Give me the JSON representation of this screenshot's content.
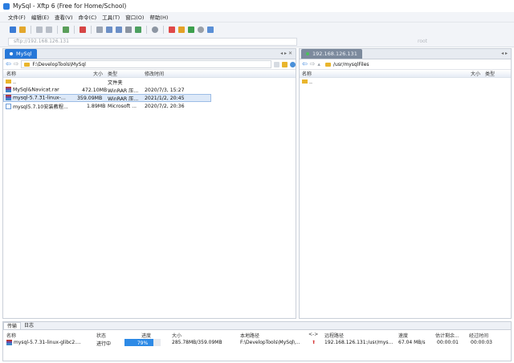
{
  "window": {
    "title": "MySql - Xftp 6 (Free for Home/School)"
  },
  "menu": [
    "文件(F)",
    "编辑(E)",
    "查看(V)",
    "命令(C)",
    "工具(T)",
    "窗口(O)",
    "帮助(H)"
  ],
  "address": {
    "value": "sftp://192.168.126.131",
    "user_placeholder": "root"
  },
  "left_pane": {
    "tab_label": "MySql",
    "path": "F:\\DevelopTools\\MySql",
    "columns": {
      "name": "名称",
      "size": "大小",
      "type": "类型",
      "modified": "修改时间"
    },
    "rows": [
      {
        "name": "..",
        "size": "",
        "type": "文件夹",
        "modified": ""
      },
      {
        "name": "MySql&Navicat.rar",
        "size": "472.10MB",
        "type": "WinRAR 压...",
        "modified": "2020/7/3, 15:27"
      },
      {
        "name": "mysql-5.7.31-linux-...",
        "size": "359.09MB",
        "type": "WinRAR 压...",
        "modified": "2021/1/2, 20:45"
      },
      {
        "name": "mysql5.7.10安装教程...",
        "size": "1.89MB",
        "type": "Microsoft ...",
        "modified": "2020/7/2, 20:36"
      }
    ]
  },
  "right_pane": {
    "tab_label": "192.168.126.131",
    "path": "/usr/mysqlFiles",
    "columns": {
      "name": "名称",
      "size": "大小",
      "type": "类型"
    },
    "rows": [
      {
        "name": ".."
      }
    ]
  },
  "transfer": {
    "tabs": [
      "传输",
      "日志"
    ],
    "columns": {
      "name": "名称",
      "status": "状态",
      "progress": "进度",
      "size": "大小",
      "local_path": "本地路径",
      "arrow": "<->",
      "remote_path": "远程路径",
      "speed": "速度",
      "eta": "估计剩余...",
      "elapsed": "经过时间"
    },
    "row": {
      "name": "mysql-5.7.31-linux-glibc2....",
      "status": "进行中",
      "progress_pct": 79,
      "progress_label": "79%",
      "size": "285.78MB/359.09MB",
      "local_path": "F:\\DevelopTools\\MySql\\...",
      "remote_path": "192.168.126.131:/usr/mys...",
      "speed": "67.04 MB/s",
      "eta": "00:00:01",
      "elapsed": "00:00:03"
    }
  },
  "colors": {
    "accent": "#2677d8",
    "progress": "#2d8ae6",
    "folder": "#e9b52d"
  }
}
